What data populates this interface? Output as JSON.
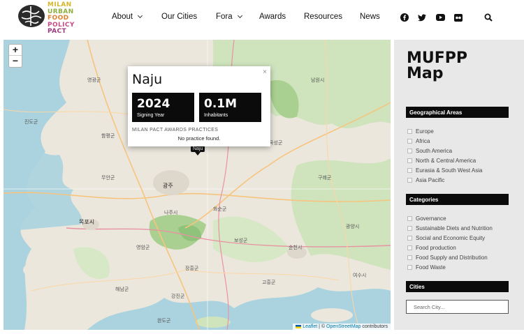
{
  "logo": {
    "lines": [
      "MILAN",
      "URBAN",
      "FOOD",
      "POLICY",
      "PACT"
    ]
  },
  "nav": {
    "items": [
      {
        "label": "About",
        "dropdown": true
      },
      {
        "label": "Our Cities",
        "dropdown": false
      },
      {
        "label": "Fora",
        "dropdown": true
      },
      {
        "label": "Awards",
        "dropdown": false
      },
      {
        "label": "Resources",
        "dropdown": false
      },
      {
        "label": "News",
        "dropdown": false
      }
    ],
    "social_icons": [
      "facebook-icon",
      "twitter-icon",
      "youtube-icon",
      "flickr-icon",
      "search-icon"
    ]
  },
  "map": {
    "zoom_in": "+",
    "zoom_out": "−",
    "popup": {
      "close": "×",
      "city": "Naju",
      "stats": [
        {
          "value": "2024",
          "label": "Signing Year"
        },
        {
          "value": "0.1M",
          "label": "Inhabitants"
        }
      ],
      "subheading": "MILAN PACT AWARDS PRACTICES",
      "empty_text": "No practice found."
    },
    "marker_label": "Naju",
    "attribution": {
      "leaflet": "Leaflet",
      "separator": " | © ",
      "osm": "OpenStreetMap",
      "suffix": " contributors"
    },
    "place_labels": [
      "목포시",
      "순천시",
      "광주",
      "무안군",
      "영암군",
      "해남군",
      "장흥군",
      "보성군",
      "화순군",
      "담양군",
      "곡성군",
      "구례군",
      "고흥군",
      "여수시",
      "광양시",
      "남원시",
      "진도군",
      "함평군",
      "영광군",
      "강진군",
      "완도군",
      "나주시"
    ]
  },
  "sidebar": {
    "title_line1": "MUFPP",
    "title_line2": "Map",
    "geo_heading": "Geographical Areas",
    "geo_options": [
      "Europe",
      "Africa",
      "South America",
      "North & Central America",
      "Eurasia & South West Asia",
      "Asia Pacific"
    ],
    "cat_heading": "Categories",
    "cat_options": [
      "Governance",
      "Sustainable Diets and Nutrition",
      "Social and Economic Equity",
      "Food production",
      "Food Supply and Distribution",
      "Food Waste"
    ],
    "cities_heading": "Cities",
    "search_placeholder": "Search City..."
  },
  "colors": {
    "accent": "#0b0b0b",
    "sidebar_bg": "#e8e8e8",
    "map_water": "#aad3df",
    "map_green": "#c6e0b0"
  }
}
